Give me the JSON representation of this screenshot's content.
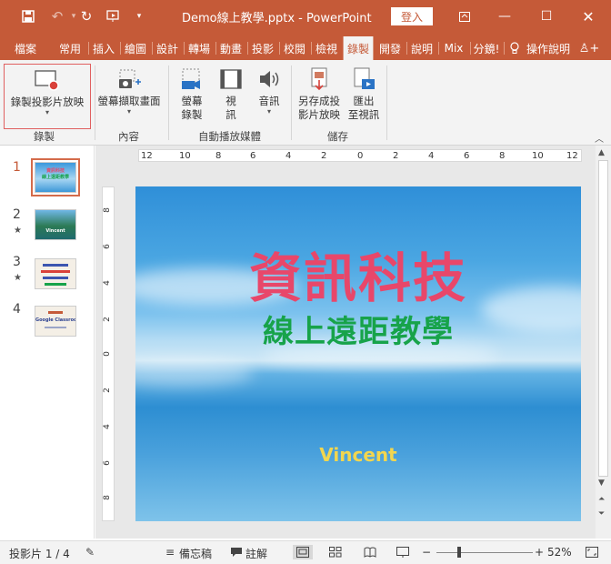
{
  "titlebar": {
    "title": "Demo線上教學.pptx - PowerPoint",
    "login": "登入",
    "bg_color": "#c55a38"
  },
  "tabs": [
    "檔案",
    "常用",
    "插入",
    "繪圖",
    "設計",
    "轉場",
    "動畫",
    "投影",
    "校閱",
    "檢視",
    "錄製",
    "開發",
    "說明",
    "Mix",
    "分鏡!",
    "操作說明"
  ],
  "active_tab": "錄製",
  "ribbon": {
    "record_slideshow": "錄製投影片放映",
    "screenshot": "螢幕擷取畫面",
    "screen_record_1": "螢幕",
    "screen_record_2": "錄製",
    "video_1": "視",
    "video_2": "訊",
    "audio": "音訊",
    "save_as_1": "另存成投",
    "save_as_2": "影片放映",
    "export_1": "匯出",
    "export_2": "至視訊",
    "group_record": "錄製",
    "group_content": "內容",
    "group_media": "自動播放媒體",
    "group_save": "儲存"
  },
  "thumbnails": [
    {
      "number": "1",
      "star": "",
      "title": "資訊科技",
      "subtitle": "線上遠距教學"
    },
    {
      "number": "2",
      "star": "★",
      "title": "",
      "subtitle": "Vincent"
    },
    {
      "number": "3",
      "star": "★",
      "title": "",
      "subtitle": ""
    },
    {
      "number": "4",
      "star": "",
      "title": "",
      "subtitle": "Google Classroom"
    }
  ],
  "ruler": {
    "h_ticks": [
      "12",
      "10",
      "8",
      "6",
      "4",
      "2",
      "0",
      "2",
      "4",
      "6",
      "8",
      "10",
      "12"
    ],
    "v_ticks": [
      "8",
      "6",
      "4",
      "2",
      "0",
      "2",
      "4",
      "6",
      "8"
    ]
  },
  "slide": {
    "title": "資訊科技",
    "subtitle": "線上遠距教學",
    "author": "Vincent",
    "title_color": "#e8476a",
    "subtitle_color": "#17a34a",
    "author_color": "#f2d64f"
  },
  "statusbar": {
    "slide_indicator": "投影片 1 / 4",
    "notes": "備忘稿",
    "comments": "註解",
    "zoom_pct": "52%",
    "zoom_minus": "−",
    "zoom_plus": "+"
  }
}
